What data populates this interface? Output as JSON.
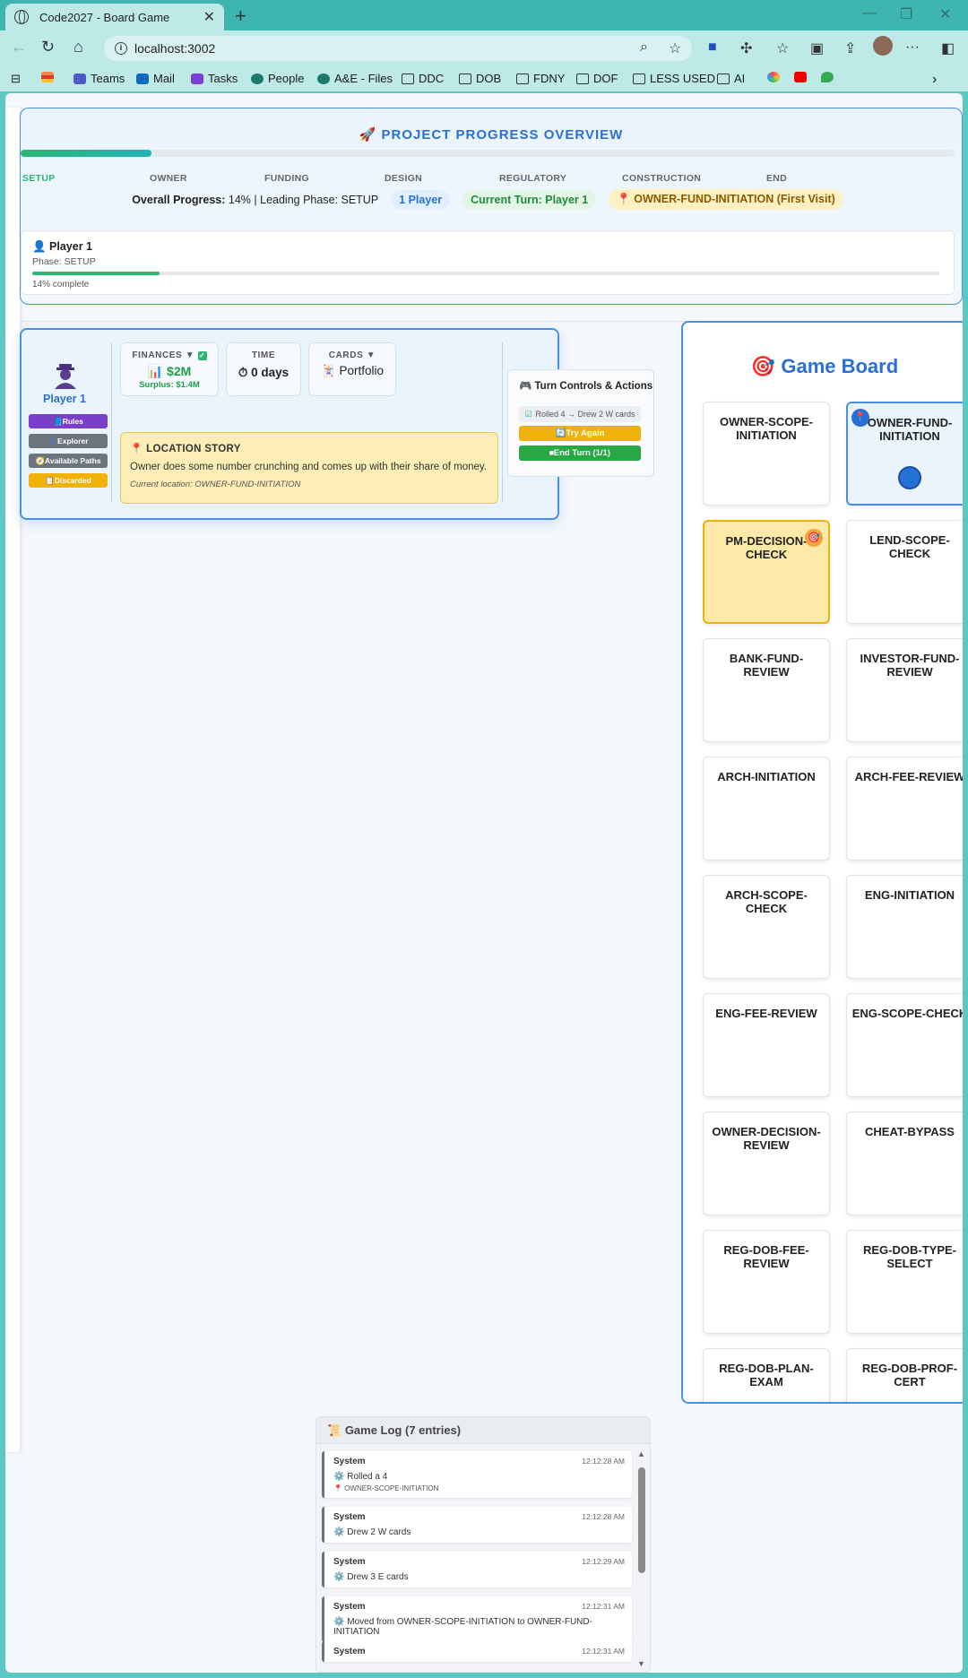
{
  "browser": {
    "tab_title": "Code2027 - Board Game",
    "new_tab": "+",
    "url": "localhost:3002",
    "bookmarks": [
      "Teams",
      "Mail",
      "Tasks",
      "People",
      "A&E - Files",
      "DDC",
      "DOB",
      "FDNY",
      "DOF",
      "LESS USED",
      "AI"
    ]
  },
  "progress": {
    "title": "PROJECT PROGRESS OVERVIEW",
    "percent": 14,
    "phases": [
      "SETUP",
      "OWNER",
      "FUNDING",
      "DESIGN",
      "REGULATORY",
      "CONSTRUCTION",
      "END"
    ],
    "active_phase": "SETUP",
    "overall_label": "Overall Progress:",
    "overall_value": "14% | Leading Phase:",
    "leading_phase": "SETUP",
    "players_pill": "1 Player",
    "turn_pill": "Current Turn: Player 1",
    "location_pill": "OWNER-FUND-INITIATION (First Visit)",
    "player": {
      "name": "Player 1",
      "phase": "Phase: SETUP",
      "complete": "14% complete"
    }
  },
  "player_panel": {
    "name": "Player 1",
    "buttons": [
      "Rules",
      "Explorer",
      "Available Paths",
      "Discarded"
    ],
    "finances_label": "FINANCES ▼",
    "finances_value": "$2M",
    "finances_surplus": "Surplus: $1.4M",
    "time_label": "TIME",
    "time_value": "0 days",
    "cards_label": "CARDS ▼",
    "cards_value": "Portfolio",
    "story_title": "LOCATION STORY",
    "story_text": "Owner does some number crunching and comes up with their share of money.",
    "story_location": "Current location: OWNER-FUND-INITIATION",
    "turn_title": "Turn Controls & Actions",
    "turn_info": "Rolled 4 → Drew 2 W cards",
    "try_again": "Try Again",
    "end_turn": "End Turn (1/1)"
  },
  "board": {
    "title": "Game Board",
    "cells": [
      "OWNER-SCOPE-INITIATION",
      "OWNER-FUND-INITIATION",
      "PM-DECISION-CHECK",
      "LEND-SCOPE-CHECK",
      "BANK-FUND-REVIEW",
      "INVESTOR-FUND-REVIEW",
      "ARCH-INITIATION",
      "ARCH-FEE-REVIEW",
      "ARCH-SCOPE-CHECK",
      "ENG-INITIATION",
      "ENG-FEE-REVIEW",
      "ENG-SCOPE-CHECK",
      "OWNER-DECISION-REVIEW",
      "CHEAT-BYPASS",
      "REG-DOB-FEE-REVIEW",
      "REG-DOB-TYPE-SELECT",
      "REG-DOB-PLAN-EXAM",
      "REG-DOB-PROF-CERT"
    ]
  },
  "log": {
    "title": "Game Log (7 entries)",
    "entries": [
      {
        "who": "System",
        "time": "12:12:28 AM",
        "msg": "Rolled a 4",
        "sub": "OWNER-SCOPE-INITIATION"
      },
      {
        "who": "System",
        "time": "12:12:28 AM",
        "msg": "Drew 2 W cards",
        "sub": ""
      },
      {
        "who": "System",
        "time": "12:12:29 AM",
        "msg": "Drew 3 E cards",
        "sub": ""
      },
      {
        "who": "System",
        "time": "12:12:31 AM",
        "msg": "Moved from OWNER-SCOPE-INITIATION to OWNER-FUND-INITIATION",
        "sub": ""
      },
      {
        "who": "System",
        "time": "12:12:31 AM",
        "msg": "",
        "sub": ""
      }
    ]
  }
}
